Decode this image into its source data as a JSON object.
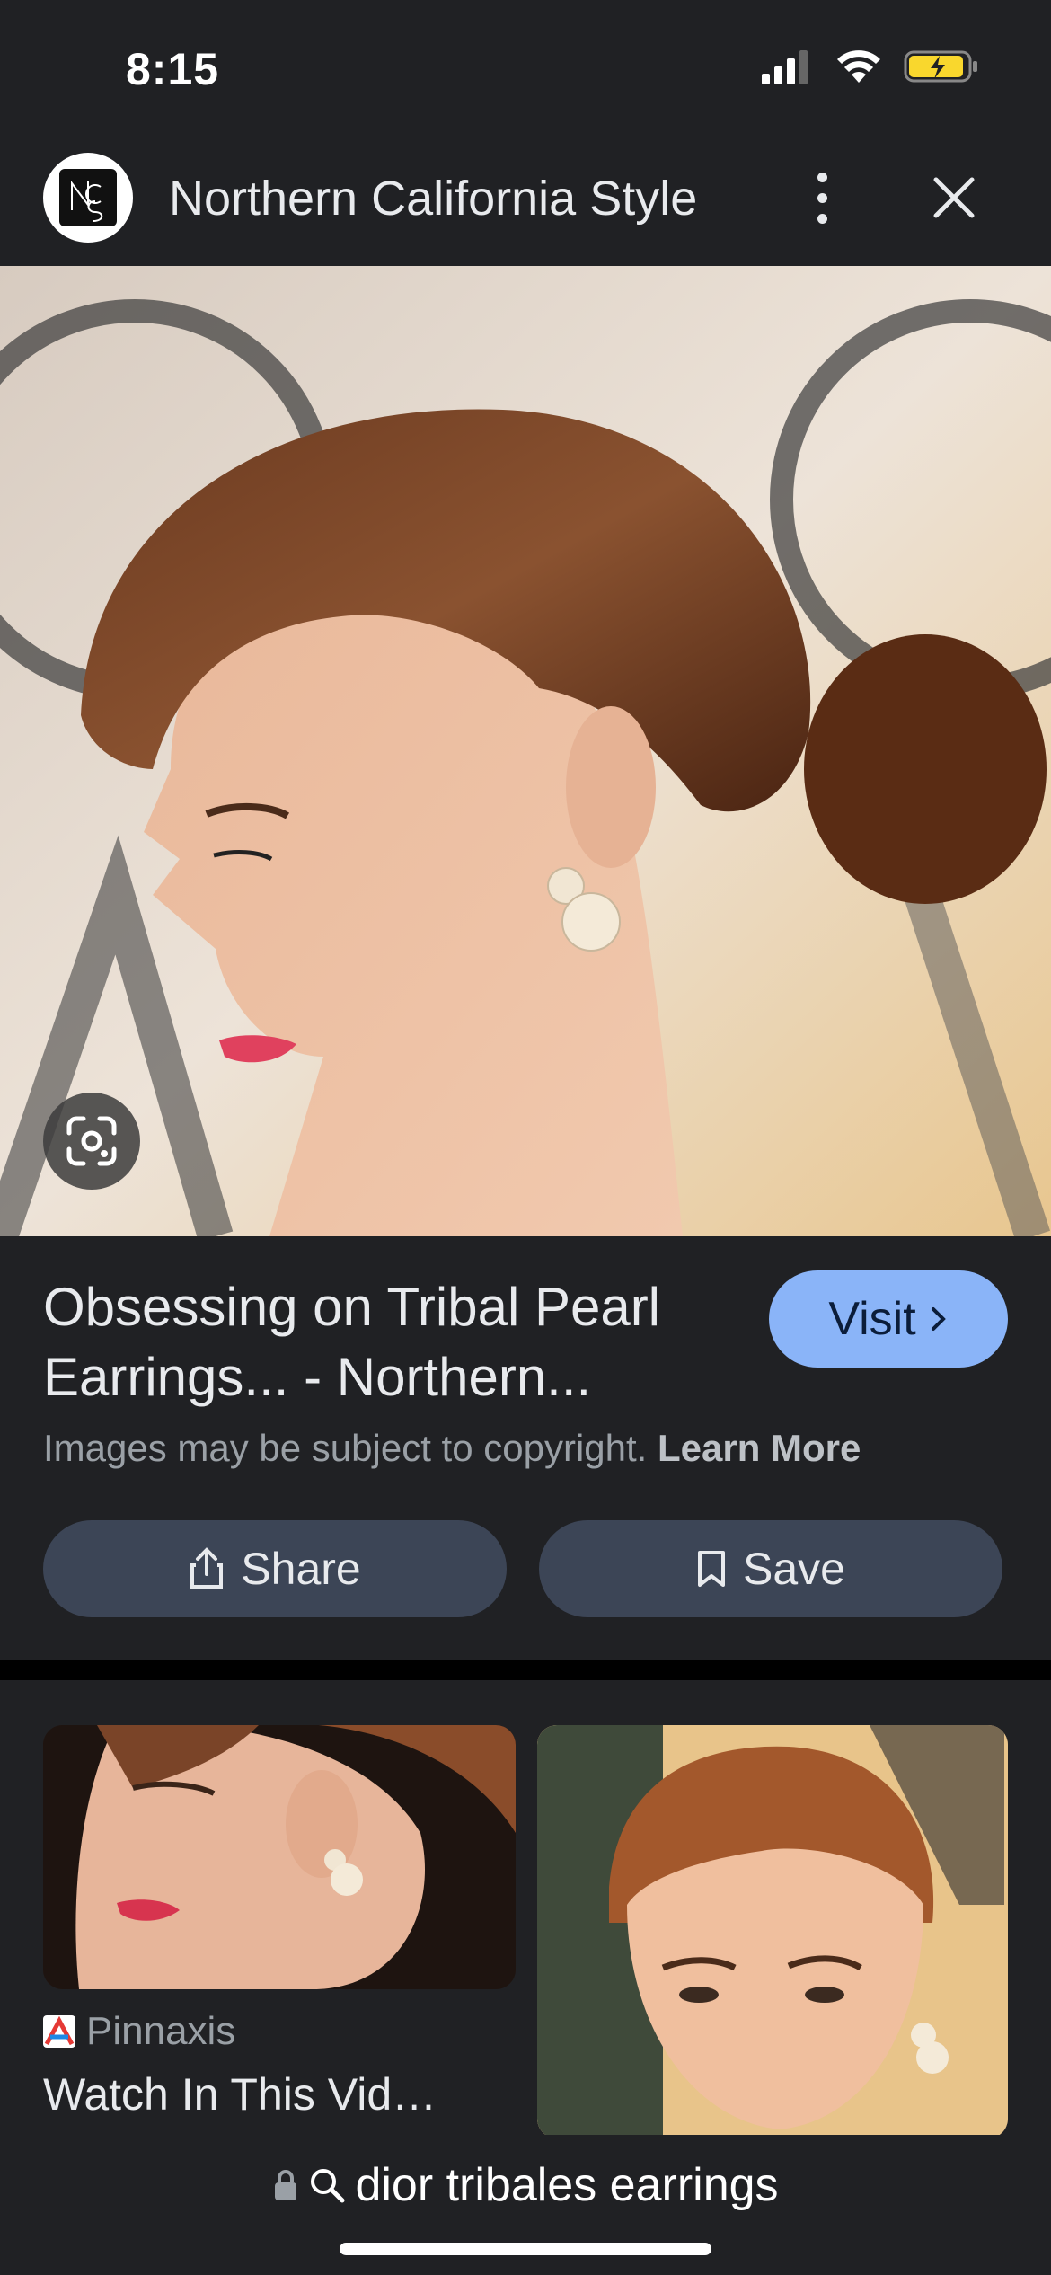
{
  "status_bar": {
    "time": "8:15",
    "icons": [
      "cellular-signal-icon",
      "wifi-icon",
      "battery-charging-icon"
    ],
    "battery_color": "#f9d72d"
  },
  "header": {
    "site_name": "Northern California Style",
    "logo_letters": "NCS",
    "icons": [
      "more-vertical-icon",
      "close-icon"
    ]
  },
  "hero": {
    "lens_icon": "google-lens-icon"
  },
  "result": {
    "title": "Obsessing on Tribal Pearl Earrings... - Northern...",
    "visit_label": "Visit",
    "visit_icon": "chevron-right-icon",
    "copyright_text": "Images may be subject to copyright.",
    "learn_more": "Learn More",
    "share_label": "Share",
    "save_label": "Save",
    "accent_color": "#8ab4f8"
  },
  "related": [
    {
      "source": "Pinnaxis",
      "title": "Watch In This Vid…"
    },
    {
      "source": "",
      "title": ""
    }
  ],
  "bottom_bar": {
    "url": "dior tribales earrings"
  }
}
